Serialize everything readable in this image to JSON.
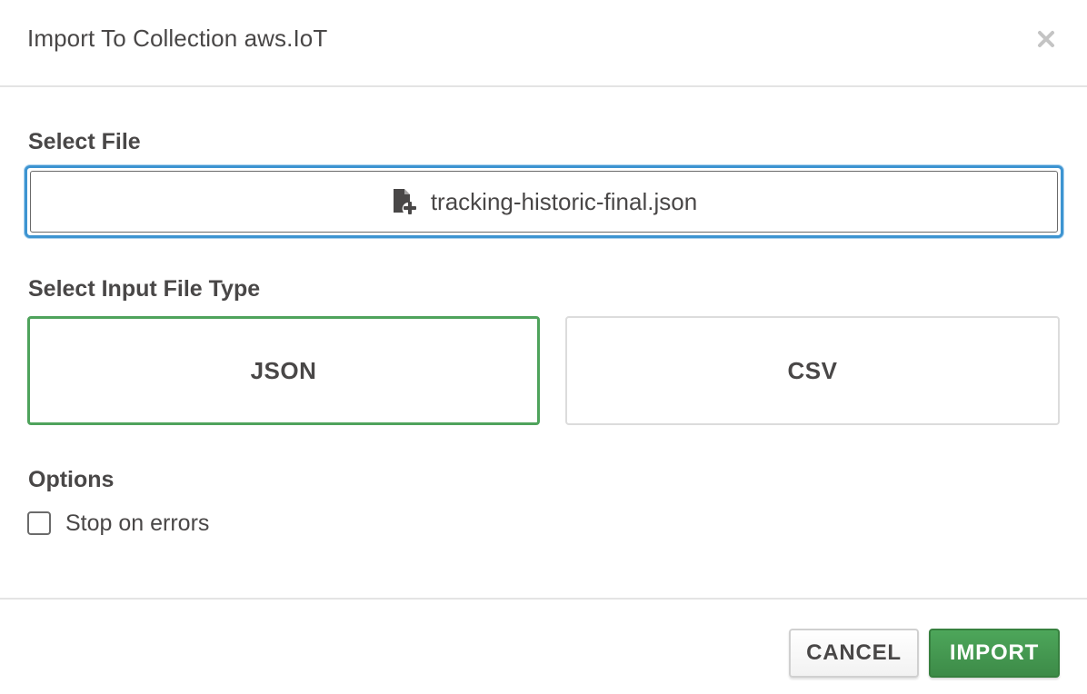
{
  "header": {
    "title": "Import To Collection aws.IoT",
    "close_icon": "close-icon"
  },
  "select_file": {
    "label": "Select File",
    "file_name": "tracking-historic-final.json",
    "icon": "file-add-icon",
    "focus_color": "#3d94d1"
  },
  "file_type": {
    "label": "Select Input File Type",
    "options": [
      "JSON",
      "CSV"
    ],
    "selected": "JSON",
    "selected_color": "#4fa35c"
  },
  "options": {
    "label": "Options",
    "stop_on_errors": {
      "label": "Stop on errors",
      "checked": false
    }
  },
  "footer": {
    "cancel_label": "CANCEL",
    "import_label": "IMPORT",
    "import_color": "#43974f"
  }
}
